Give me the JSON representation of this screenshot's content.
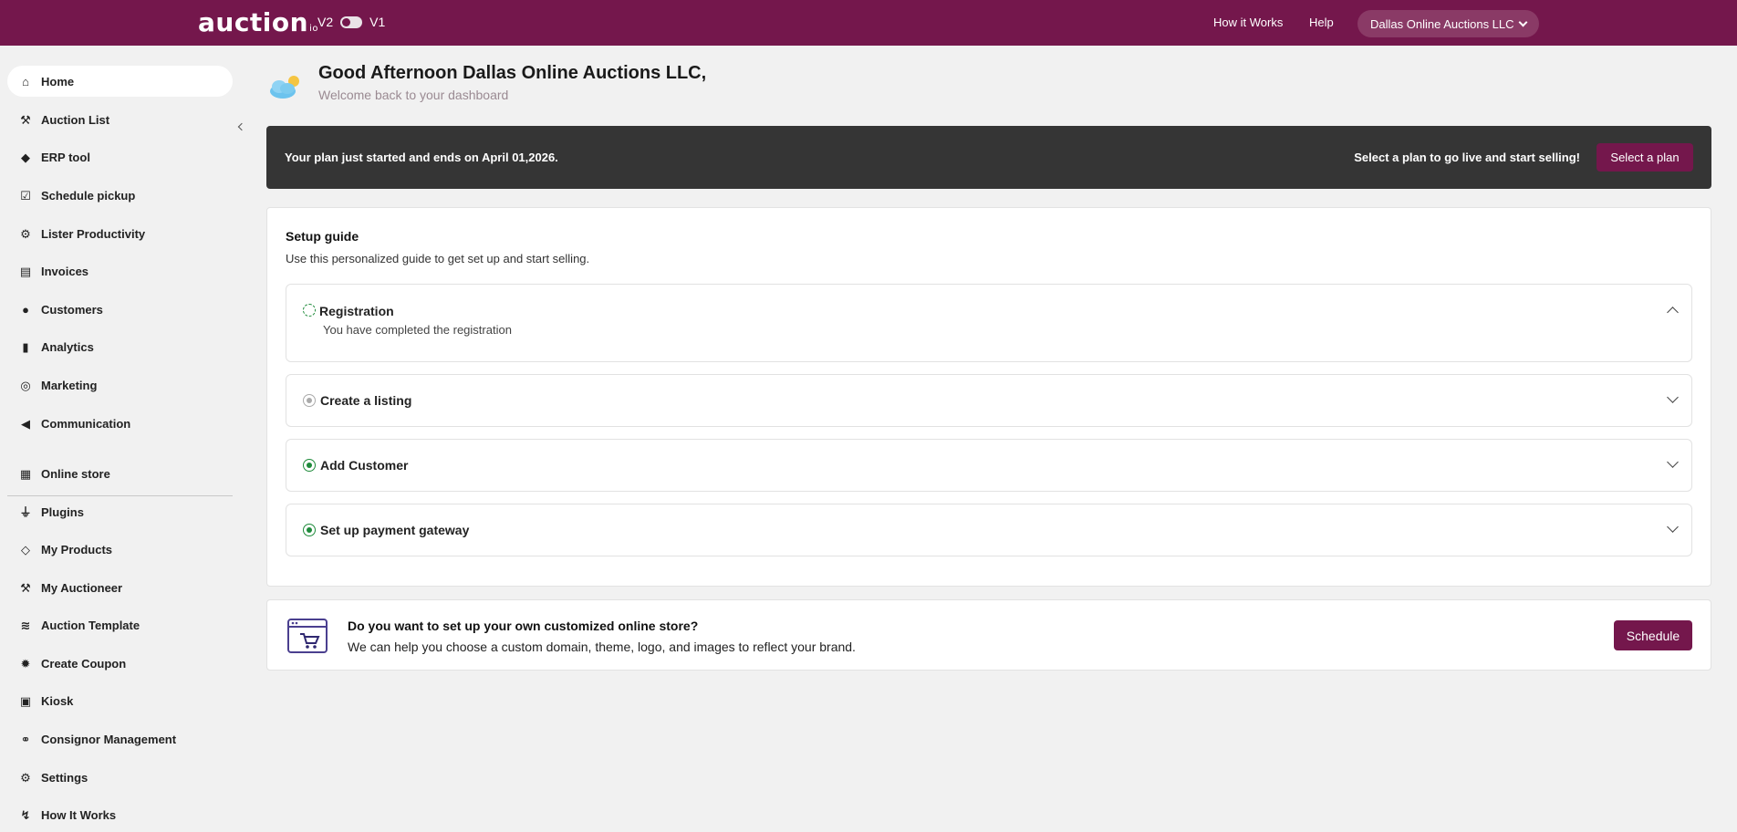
{
  "header": {
    "logo_text": "auction",
    "logo_suffix": "io",
    "version_left": "V2",
    "version_right": "V1",
    "links": [
      "How it Works",
      "Help"
    ],
    "account": "Dallas Online Auctions LLC"
  },
  "sidebar": {
    "items": [
      {
        "label": "Home",
        "icon": "home-icon"
      },
      {
        "label": "Auction List",
        "icon": "gavel-icon"
      },
      {
        "label": "ERP tool",
        "icon": "tag-icon"
      },
      {
        "label": "Schedule pickup",
        "icon": "calendar-check-icon"
      },
      {
        "label": "Lister Productivity",
        "icon": "gears-icon"
      },
      {
        "label": "Invoices",
        "icon": "document-icon"
      },
      {
        "label": "Customers",
        "icon": "user-icon"
      },
      {
        "label": "Analytics",
        "icon": "bar-chart-icon"
      },
      {
        "label": "Marketing",
        "icon": "target-icon"
      },
      {
        "label": "Communication",
        "icon": "megaphone-icon"
      },
      {
        "label": "Online store",
        "icon": "store-icon"
      },
      {
        "label": "Plugins",
        "icon": "plug-icon"
      },
      {
        "label": "My Products",
        "icon": "tag-outline-icon"
      },
      {
        "label": "My Auctioneer",
        "icon": "gavel-icon"
      },
      {
        "label": "Auction Template",
        "icon": "layers-icon"
      },
      {
        "label": "Create Coupon",
        "icon": "badge-icon"
      },
      {
        "label": "Kiosk",
        "icon": "kiosk-icon"
      },
      {
        "label": "Consignor Management",
        "icon": "handshake-icon"
      },
      {
        "label": "Settings",
        "icon": "gear-icon"
      },
      {
        "label": "How It Works",
        "icon": "flow-icon"
      }
    ]
  },
  "greeting": {
    "title": "Good Afternoon Dallas Online Auctions LLC,",
    "subtitle": "Welcome back to your dashboard"
  },
  "plan": {
    "message": "Your plan just started and ends on April 01,2026.",
    "cta_text": "Select a plan to go live and start selling!",
    "button": "Select a plan"
  },
  "setup_guide": {
    "title": "Setup guide",
    "description": "Use this personalized guide to get set up and start selling.",
    "steps": [
      {
        "title": "Registration",
        "detail": "You have completed the registration",
        "status": "in-progress"
      },
      {
        "title": "Create a listing",
        "status": "pending"
      },
      {
        "title": "Add Customer",
        "status": "done"
      },
      {
        "title": "Set up payment gateway",
        "status": "done"
      }
    ]
  },
  "store_promo": {
    "title": "Do you want to set up your own customized online store?",
    "description": "We can help you choose a custom domain, theme, logo, and images to reflect your brand.",
    "button": "Schedule"
  },
  "colors": {
    "brand": "#74174c",
    "plan_bar": "#353535",
    "success": "#1e8a3a"
  }
}
